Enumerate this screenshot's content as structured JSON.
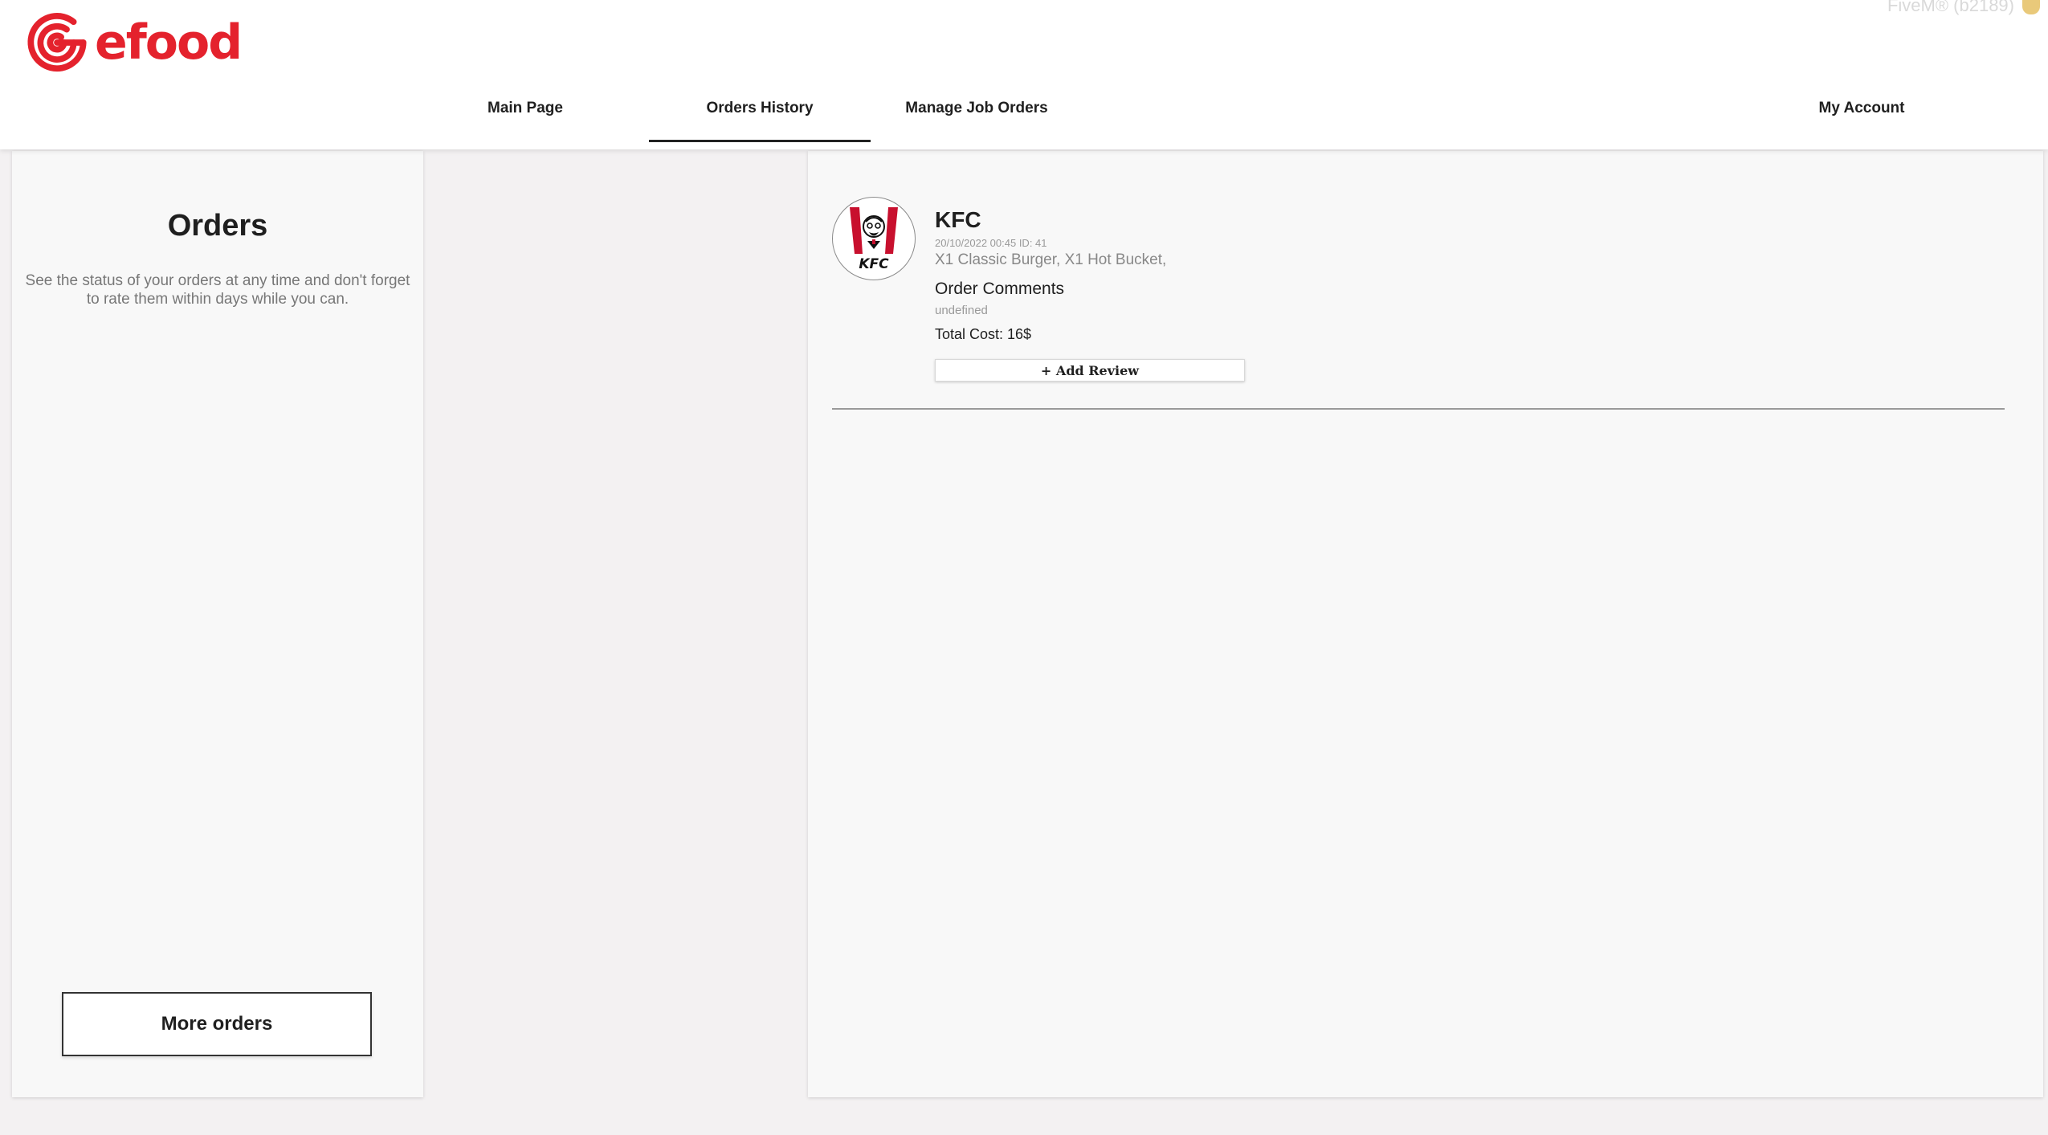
{
  "brand": {
    "name": "efood",
    "color": "#e4222d",
    "icon": "efood-swirl-logo-icon"
  },
  "watermark": {
    "text": "FiveM® (b2189)"
  },
  "nav": {
    "items": [
      {
        "label": "Main Page"
      },
      {
        "label": "Orders History",
        "active": true
      },
      {
        "label": "Manage Job Orders"
      },
      {
        "label": "My Account"
      }
    ]
  },
  "orders_panel": {
    "title": "Orders",
    "description": "See the status of your orders at any time and don't forget to rate them within days while you can.",
    "more_button": "More orders"
  },
  "orders": [
    {
      "restaurant": "KFC",
      "logo_icon": "kfc-logo-icon",
      "logo_text": "KFC",
      "meta": "20/10/2022 00:45 ID: 41",
      "items": "X1 Classic Burger, X1 Hot Bucket,",
      "comments_label": "Order Comments",
      "comments_value": "undefined",
      "total": "Total Cost: 16$",
      "review_button": "+ Add Review"
    }
  ]
}
